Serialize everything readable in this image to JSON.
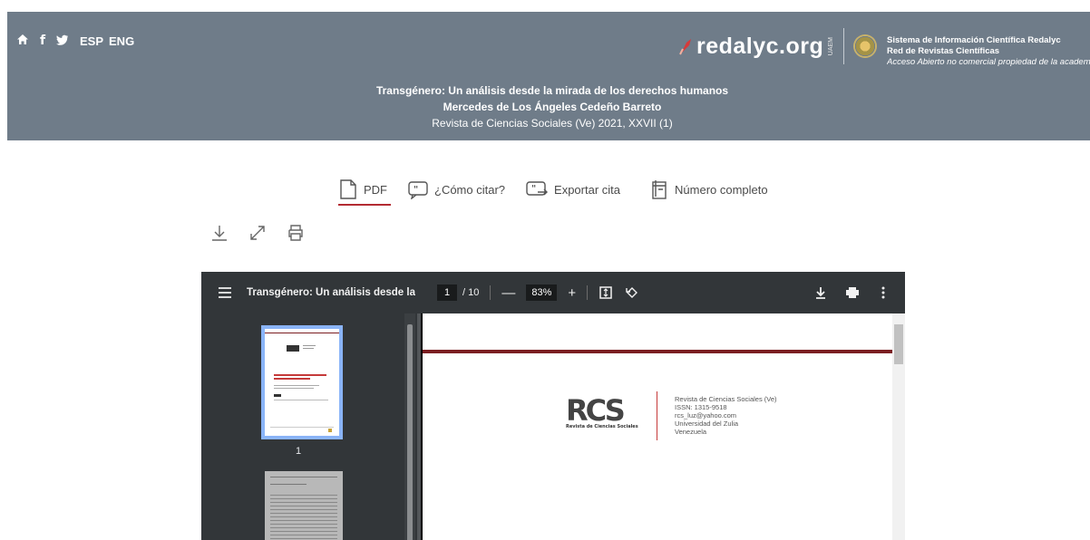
{
  "header": {
    "nav_icons": [
      "home-icon",
      "facebook-icon",
      "twitter-icon"
    ],
    "lang_esp": "ESP",
    "lang_eng": "ENG",
    "logo_text": "redalyc.org",
    "logo_sub": "UAEM",
    "sys_line1": "Sistema de Información Científica Redalyc",
    "sys_line2": "Red de Revistas Científicas",
    "sys_line3": "Acceso Abierto no comercial propiedad de la academ",
    "article_title": "Transgénero: Un análisis desde la mirada de los derechos humanos",
    "article_author": "Mercedes de Los Ángeles Cedeño Barreto",
    "article_journal": "Revista de Ciencias Sociales (Ve) 2021, XXVII (1)",
    "bg_color": "#6f7c89"
  },
  "tabs": [
    {
      "label": "PDF",
      "icon": "file-icon",
      "active": true
    },
    {
      "label": "¿Cómo citar?",
      "icon": "quote-icon",
      "active": false
    },
    {
      "label": "Exportar cita",
      "icon": "export-quote-icon",
      "active": false
    },
    {
      "label": "Número completo",
      "icon": "book-icon",
      "active": false
    }
  ],
  "tools": [
    "download-icon",
    "expand-icon",
    "print-icon"
  ],
  "viewer": {
    "doc_title": "Transgénero: Un análisis desde la mira...",
    "page_current": "1",
    "page_total": "/ 10",
    "zoom": "83%",
    "thumb_page_number": "1",
    "page_info": {
      "journal": "Revista de Ciencias Sociales (Ve)",
      "issn": "ISSN: 1315-9518",
      "email": "rcs_luz@yahoo.com",
      "university": "Universidad del Zulia",
      "country": "Venezuela"
    },
    "logo_text": "RCS",
    "logo_caption": "Revista de Ciencias Sociales"
  },
  "accent_color": "#b32b32"
}
